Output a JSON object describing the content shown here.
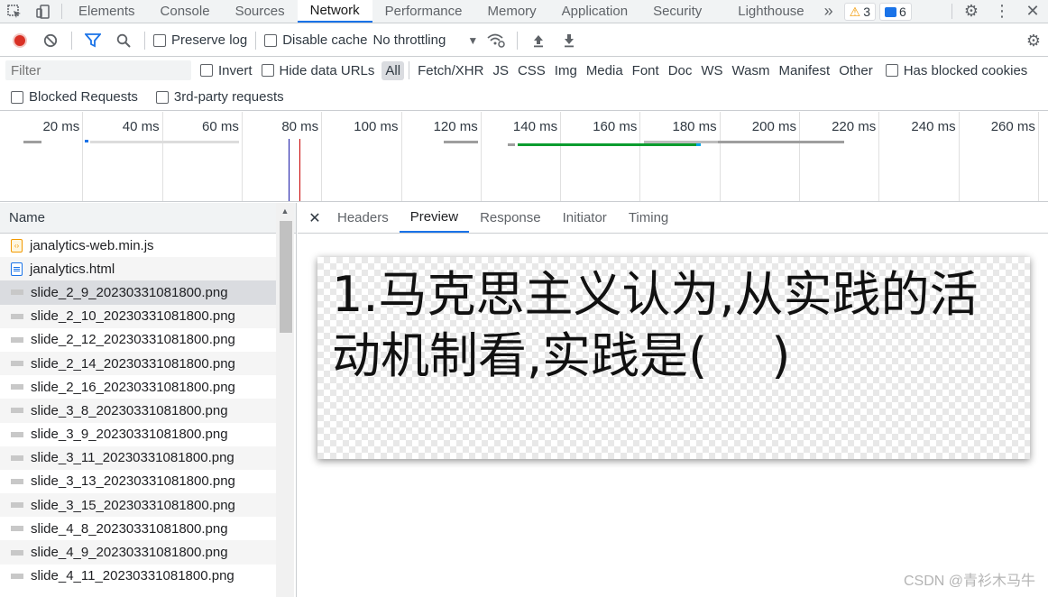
{
  "top_tabs": {
    "items": [
      "Elements",
      "Console",
      "Sources",
      "Network",
      "Performance",
      "Memory",
      "Application",
      "Security",
      "Lighthouse"
    ],
    "active": "Network",
    "more": "»",
    "warnings_count": "3",
    "messages_count": "6"
  },
  "toolbar": {
    "preserve_log": "Preserve log",
    "disable_cache": "Disable cache",
    "throttling": "No throttling"
  },
  "filter": {
    "placeholder": "Filter",
    "invert": "Invert",
    "hide_data_urls": "Hide data URLs",
    "types": [
      "All",
      "Fetch/XHR",
      "JS",
      "CSS",
      "Img",
      "Media",
      "Font",
      "Doc",
      "WS",
      "Wasm",
      "Manifest",
      "Other"
    ],
    "selected_type": "All",
    "has_blocked_cookies": "Has blocked cookies",
    "blocked_requests": "Blocked Requests",
    "third_party": "3rd-party requests"
  },
  "overview": {
    "labels": [
      "20 ms",
      "40 ms",
      "60 ms",
      "80 ms",
      "100 ms",
      "120 ms",
      "140 ms",
      "160 ms",
      "180 ms",
      "200 ms",
      "220 ms",
      "240 ms",
      "260 ms"
    ],
    "colors": {
      "dom_content_loaded": "#1a1aa6",
      "load": "#c80000",
      "download": "#0a9d2f",
      "waiting": "#9e9e9e"
    }
  },
  "list": {
    "header": "Name",
    "rows": [
      {
        "name": "janalytics-web.min.js",
        "type": "js"
      },
      {
        "name": "janalytics.html",
        "type": "html"
      },
      {
        "name": "slide_2_9_20230331081800.png",
        "type": "img",
        "selected": true
      },
      {
        "name": "slide_2_10_20230331081800.png",
        "type": "img"
      },
      {
        "name": "slide_2_12_20230331081800.png",
        "type": "img"
      },
      {
        "name": "slide_2_14_20230331081800.png",
        "type": "img"
      },
      {
        "name": "slide_2_16_20230331081800.png",
        "type": "img"
      },
      {
        "name": "slide_3_8_20230331081800.png",
        "type": "img"
      },
      {
        "name": "slide_3_9_20230331081800.png",
        "type": "img"
      },
      {
        "name": "slide_3_11_20230331081800.png",
        "type": "img"
      },
      {
        "name": "slide_3_13_20230331081800.png",
        "type": "img"
      },
      {
        "name": "slide_3_15_20230331081800.png",
        "type": "img"
      },
      {
        "name": "slide_4_8_20230331081800.png",
        "type": "img"
      },
      {
        "name": "slide_4_9_20230331081800.png",
        "type": "img"
      },
      {
        "name": "slide_4_11_20230331081800.png",
        "type": "img"
      }
    ]
  },
  "detail": {
    "tabs": [
      "Headers",
      "Preview",
      "Response",
      "Initiator",
      "Timing"
    ],
    "active_tab": "Preview",
    "preview_text": "1.马克思主义认为,从实践的活动机制看,实践是(　 )"
  },
  "watermark": "CSDN @青衫木马牛"
}
